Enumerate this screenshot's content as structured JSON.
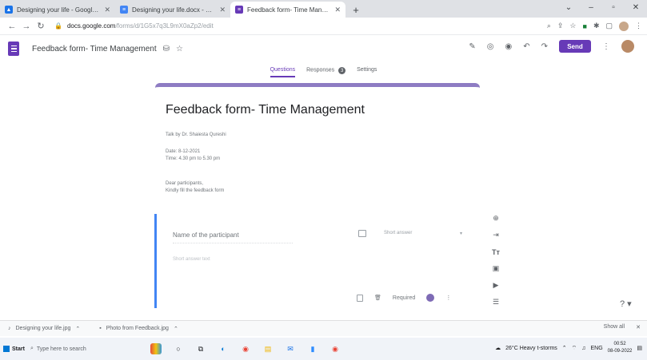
{
  "browser": {
    "tabs": [
      {
        "title": "Designing your life - Google Dri",
        "favicon": "drive-icon",
        "active": false
      },
      {
        "title": "Designing your life.docx - Goog",
        "favicon": "docs-icon",
        "active": false
      },
      {
        "title": "Feedback form- Time Managem",
        "favicon": "forms-icon",
        "active": true
      }
    ],
    "url_host": "docs.google.com",
    "url_path": "/forms/d/1G5x7q3L9mX0aZp2/edit"
  },
  "form_header": {
    "doc_title": "Feedback form- Time Management",
    "send_label": "Send"
  },
  "sub_tabs": {
    "questions": "Questions",
    "responses": "Responses",
    "responses_count": "3",
    "settings": "Settings"
  },
  "form": {
    "title": "Feedback form- Time Management",
    "talk_by": "Talk by Dr. Shaiesta Qureshi",
    "date": "Date: 8-12-2021",
    "time": "Time: 4.30 pm to 5.30 pm",
    "greeting": "Dear participants,",
    "instruction": "Kindly fill the feedback form"
  },
  "question": {
    "label": "Name of the participant",
    "short_answer_hint": "Short answer text",
    "type": "Short answer",
    "required_label": "Required"
  },
  "downloads": {
    "item1": "Designing your life.jpg",
    "item2": "Photo from Feedback.jpg",
    "show_all": "Show all"
  },
  "taskbar": {
    "start_label": "Start",
    "search_placeholder": "Type here to search",
    "weather": "26°C  Heavy t-storms",
    "language": "ENG",
    "time": "00:52",
    "date": "08-09-2022"
  },
  "colors": {
    "forms_purple": "#673ab7",
    "accent_blue": "#4285f4"
  }
}
